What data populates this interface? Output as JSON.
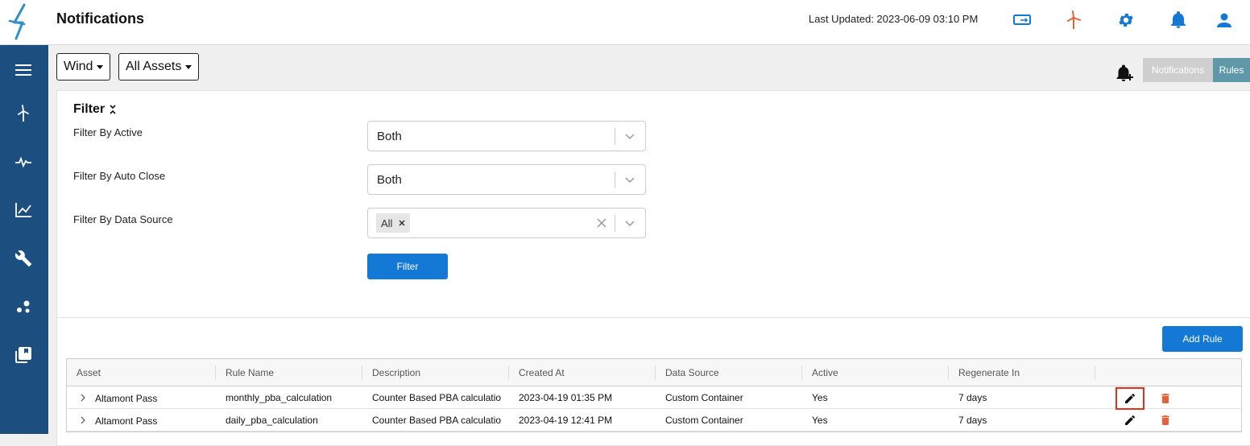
{
  "header": {
    "title": "Notifications",
    "last_updated": "Last Updated: 2023-06-09 03:10 PM",
    "icons": [
      "screen-swap-icon",
      "wind-turbine-icon",
      "gear-icon",
      "bell-icon",
      "user-icon"
    ]
  },
  "sidebar": {
    "items": [
      "menu-icon",
      "wind-turbine-icon",
      "pulse-icon",
      "line-chart-icon",
      "wrench-icon",
      "scatter-icon",
      "library-icon"
    ]
  },
  "toolbar": {
    "wind_dropdown": "Wind",
    "assets_dropdown": "All Assets",
    "seg_notifications": "Notifications",
    "seg_rules": "Rules"
  },
  "filter": {
    "title": "Filter",
    "active_label": "Filter By Active",
    "active_value": "Both",
    "auto_close_label": "Filter By Auto Close",
    "auto_close_value": "Both",
    "data_source_label": "Filter By Data Source",
    "data_source_chip": "All",
    "button": "Filter"
  },
  "table": {
    "add_rule": "Add Rule",
    "columns": [
      "Asset",
      "Rule Name",
      "Description",
      "Created At",
      "Data Source",
      "Active",
      "Regenerate In"
    ],
    "rows": [
      {
        "asset": "Altamont Pass",
        "rule_name": "monthly_pba_calculation",
        "description": "Counter Based PBA calculatio",
        "created_at": "2023-04-19 01:35 PM",
        "data_source": "Custom Container",
        "active": "Yes",
        "regenerate_in": "7 days"
      },
      {
        "asset": "Altamont Pass",
        "rule_name": "daily_pba_calculation",
        "description": "Counter Based PBA calculatio",
        "created_at": "2023-04-19 12:41 PM",
        "data_source": "Custom Container",
        "active": "Yes",
        "regenerate_in": "7 days"
      }
    ]
  },
  "colors": {
    "sidebar": "#1c4f80",
    "primary_button": "#1479d4",
    "icon_blue": "#1479d4",
    "turbine_orange": "#e8603c",
    "delete_red": "#e8603c",
    "highlight": "#e0301e"
  }
}
